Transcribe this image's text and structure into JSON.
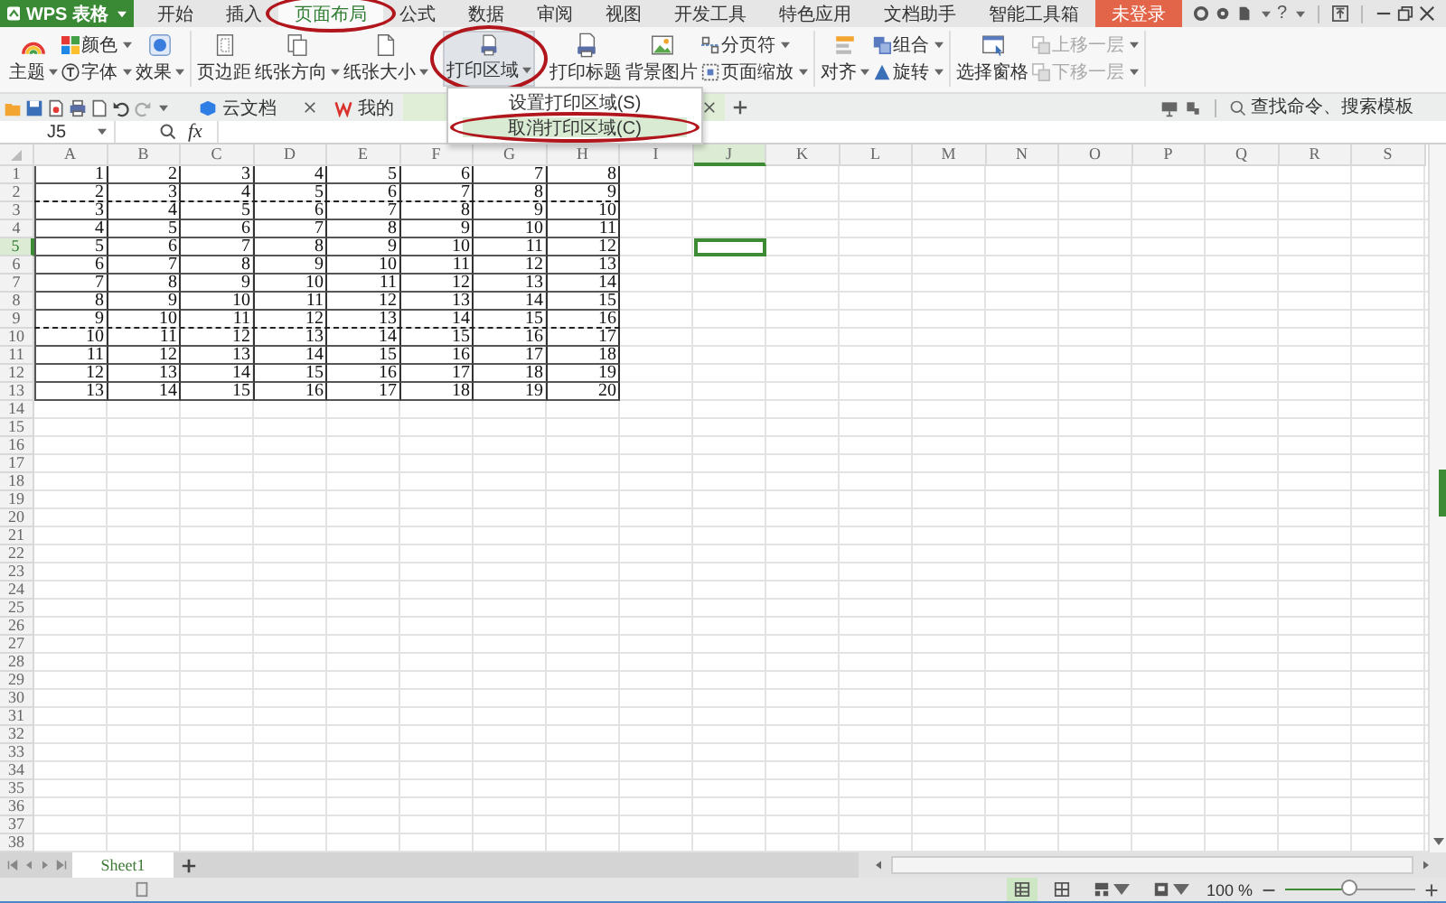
{
  "app_button": {
    "label": "WPS 表格"
  },
  "menu_tabs": [
    {
      "label": "开始",
      "selected": false,
      "circled": false
    },
    {
      "label": "插入",
      "selected": false,
      "circled": false
    },
    {
      "label": "页面布局",
      "selected": true,
      "circled": true
    },
    {
      "label": "公式",
      "selected": false,
      "circled": false
    },
    {
      "label": "数据",
      "selected": false,
      "circled": false
    },
    {
      "label": "审阅",
      "selected": false,
      "circled": false
    },
    {
      "label": "视图",
      "selected": false,
      "circled": false
    },
    {
      "label": "开发工具",
      "selected": false,
      "circled": false
    },
    {
      "label": "特色应用",
      "selected": false,
      "circled": false
    },
    {
      "label": "文档助手",
      "selected": false,
      "circled": false
    },
    {
      "label": "智能工具箱",
      "selected": false,
      "circled": false
    }
  ],
  "login_button": {
    "label": "未登录"
  },
  "help_button": {
    "label": "?"
  },
  "ribbon": {
    "groups": [
      {
        "items": [
          {
            "kind": "large",
            "label": "主题",
            "dropdown": true,
            "pressed": false,
            "circled": false
          },
          {
            "kind": "stack",
            "buttons": [
              {
                "label": "颜色",
                "dropdown": true,
                "disabled": false
              },
              {
                "label": "字体",
                "dropdown": true,
                "disabled": false
              }
            ]
          },
          {
            "kind": "large",
            "label": "效果",
            "dropdown": true,
            "pressed": false,
            "circled": false
          }
        ]
      },
      {
        "items": [
          {
            "kind": "large",
            "label": "页边距",
            "dropdown": false,
            "pressed": false,
            "circled": false
          },
          {
            "kind": "large",
            "label": "纸张方向",
            "dropdown": true,
            "pressed": false,
            "circled": false
          },
          {
            "kind": "large",
            "label": "纸张大小",
            "dropdown": true,
            "pressed": false,
            "circled": false
          },
          {
            "kind": "large",
            "label": "打印区域",
            "dropdown": true,
            "pressed": true,
            "circled": true,
            "menu": [
              {
                "label": "设置打印区域(S)",
                "selected": false,
                "circled": false
              },
              {
                "label": "取消打印区域(C)",
                "selected": true,
                "circled": true
              }
            ]
          },
          {
            "kind": "large",
            "label": "打印标题",
            "dropdown": false,
            "pressed": false,
            "circled": false
          },
          {
            "kind": "large",
            "label": "背景图片",
            "dropdown": false,
            "pressed": false,
            "circled": false
          },
          {
            "kind": "stack",
            "buttons": [
              {
                "label": "分页符",
                "dropdown": true,
                "disabled": false
              },
              {
                "label": "页面缩放",
                "dropdown": true,
                "disabled": false
              }
            ]
          }
        ]
      },
      {
        "items": [
          {
            "kind": "large",
            "label": "对齐",
            "dropdown": true,
            "pressed": false,
            "circled": false
          },
          {
            "kind": "stack",
            "buttons": [
              {
                "label": "组合",
                "dropdown": true,
                "disabled": false
              },
              {
                "label": "旋转",
                "dropdown": true,
                "disabled": false
              }
            ]
          }
        ]
      },
      {
        "items": [
          {
            "kind": "large",
            "label": "选择窗格",
            "dropdown": false,
            "pressed": false,
            "circled": false
          },
          {
            "kind": "stack",
            "buttons": [
              {
                "label": "上移一层",
                "dropdown": true,
                "disabled": true
              },
              {
                "label": "下移一层",
                "dropdown": true,
                "disabled": true
              }
            ]
          }
        ]
      }
    ]
  },
  "doc_tabs": [
    {
      "label": "云文档",
      "selected": false
    },
    {
      "label": "我的",
      "selected": false
    },
    {
      "selected": true
    }
  ],
  "search": {
    "placeholder": "查找命令、搜索模板"
  },
  "formula_bar": {
    "name_box": "J5",
    "function_label": "fx"
  },
  "grid": {
    "columns": [
      {
        "label": "A",
        "selected": false
      },
      {
        "label": "B",
        "selected": false
      },
      {
        "label": "C",
        "selected": false
      },
      {
        "label": "D",
        "selected": false
      },
      {
        "label": "E",
        "selected": false
      },
      {
        "label": "F",
        "selected": false
      },
      {
        "label": "G",
        "selected": false
      },
      {
        "label": "H",
        "selected": false
      },
      {
        "label": "I",
        "selected": false
      },
      {
        "label": "J",
        "selected": true
      },
      {
        "label": "K",
        "selected": false
      },
      {
        "label": "L",
        "selected": false
      },
      {
        "label": "M",
        "selected": false
      },
      {
        "label": "N",
        "selected": false
      },
      {
        "label": "O",
        "selected": false
      },
      {
        "label": "P",
        "selected": false
      },
      {
        "label": "Q",
        "selected": false
      },
      {
        "label": "R",
        "selected": false
      },
      {
        "label": "S",
        "selected": false
      }
    ],
    "rows": [
      {
        "label": "1",
        "selected": false,
        "page_break": false,
        "cells": [
          "1",
          "2",
          "3",
          "4",
          "5",
          "6",
          "7",
          "8"
        ]
      },
      {
        "label": "2",
        "selected": false,
        "page_break": true,
        "cells": [
          "2",
          "3",
          "4",
          "5",
          "6",
          "7",
          "8",
          "9"
        ]
      },
      {
        "label": "3",
        "selected": false,
        "page_break": false,
        "cells": [
          "3",
          "4",
          "5",
          "6",
          "7",
          "8",
          "9",
          "10"
        ]
      },
      {
        "label": "4",
        "selected": false,
        "page_break": false,
        "cells": [
          "4",
          "5",
          "6",
          "7",
          "8",
          "9",
          "10",
          "11"
        ]
      },
      {
        "label": "5",
        "selected": true,
        "page_break": false,
        "cells": [
          "5",
          "6",
          "7",
          "8",
          "9",
          "10",
          "11",
          "12"
        ]
      },
      {
        "label": "6",
        "selected": false,
        "page_break": false,
        "cells": [
          "6",
          "7",
          "8",
          "9",
          "10",
          "11",
          "12",
          "13"
        ]
      },
      {
        "label": "7",
        "selected": false,
        "page_break": false,
        "cells": [
          "7",
          "8",
          "9",
          "10",
          "11",
          "12",
          "13",
          "14"
        ]
      },
      {
        "label": "8",
        "selected": false,
        "page_break": false,
        "cells": [
          "8",
          "9",
          "10",
          "11",
          "12",
          "13",
          "14",
          "15"
        ]
      },
      {
        "label": "9",
        "selected": false,
        "page_break": true,
        "cells": [
          "9",
          "10",
          "11",
          "12",
          "13",
          "14",
          "15",
          "16"
        ]
      },
      {
        "label": "10",
        "selected": false,
        "page_break": false,
        "cells": [
          "10",
          "11",
          "12",
          "13",
          "14",
          "15",
          "16",
          "17"
        ]
      },
      {
        "label": "11",
        "selected": false,
        "page_break": false,
        "cells": [
          "11",
          "12",
          "13",
          "14",
          "15",
          "16",
          "17",
          "18"
        ]
      },
      {
        "label": "12",
        "selected": false,
        "page_break": false,
        "cells": [
          "12",
          "13",
          "14",
          "15",
          "16",
          "17",
          "18",
          "19"
        ]
      },
      {
        "label": "13",
        "selected": false,
        "page_break": false,
        "cells": [
          "13",
          "14",
          "15",
          "16",
          "17",
          "18",
          "19",
          "20"
        ]
      },
      {
        "label": "14",
        "selected": false,
        "page_break": false
      },
      {
        "label": "15",
        "selected": false,
        "page_break": false
      },
      {
        "label": "16",
        "selected": false,
        "page_break": false
      },
      {
        "label": "17",
        "selected": false,
        "page_break": false
      },
      {
        "label": "18",
        "selected": false,
        "page_break": false
      },
      {
        "label": "19",
        "selected": false,
        "page_break": false
      },
      {
        "label": "20",
        "selected": false,
        "page_break": false
      },
      {
        "label": "21",
        "selected": false,
        "page_break": false
      },
      {
        "label": "22",
        "selected": false,
        "page_break": false
      },
      {
        "label": "23",
        "selected": false,
        "page_break": false
      },
      {
        "label": "24",
        "selected": false,
        "page_break": false
      },
      {
        "label": "25",
        "selected": false,
        "page_break": false
      },
      {
        "label": "26",
        "selected": false,
        "page_break": false
      },
      {
        "label": "27",
        "selected": false,
        "page_break": false
      },
      {
        "label": "28",
        "selected": false,
        "page_break": false
      },
      {
        "label": "29",
        "selected": false,
        "page_break": false
      },
      {
        "label": "30",
        "selected": false,
        "page_break": false
      },
      {
        "label": "31",
        "selected": false,
        "page_break": false
      },
      {
        "label": "32",
        "selected": false,
        "page_break": false
      },
      {
        "label": "33",
        "selected": false,
        "page_break": false
      },
      {
        "label": "34",
        "selected": false,
        "page_break": false
      },
      {
        "label": "35",
        "selected": false,
        "page_break": false
      },
      {
        "label": "36",
        "selected": false,
        "page_break": false
      },
      {
        "label": "37",
        "selected": false,
        "page_break": false
      },
      {
        "label": "38",
        "selected": false,
        "page_break": false
      }
    ]
  },
  "sheet_tabs": [
    {
      "label": "Sheet1",
      "selected": true
    }
  ],
  "status_bar": {
    "views": [
      {
        "selected": true
      },
      {
        "selected": false
      },
      {
        "selected": false
      },
      {
        "selected": false
      }
    ],
    "zoom_text": "100 %",
    "zoom": {
      "level": 0.5
    }
  }
}
